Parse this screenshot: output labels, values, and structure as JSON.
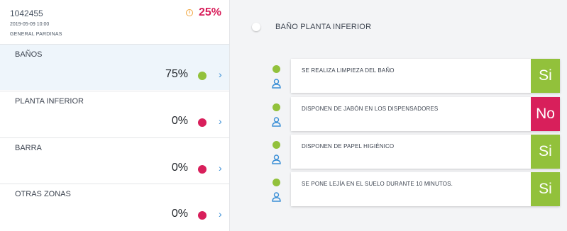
{
  "header": {
    "id": "1042455",
    "date": "2019-05-09 10:00",
    "place": "GENERAL PARDINAS",
    "score": "25%"
  },
  "colors": {
    "green": "#92c13b",
    "pink": "#d81f5b",
    "blue": "#3b8fd6",
    "orange": "#f0a43a"
  },
  "zones": [
    {
      "name": "BAÑOS",
      "percent": "75%",
      "status": "green",
      "active": true
    },
    {
      "name": "PLANTA INFERIOR",
      "percent": "0%",
      "status": "pink",
      "active": false
    },
    {
      "name": "BARRA",
      "percent": "0%",
      "status": "pink",
      "active": false
    },
    {
      "name": "OTRAS ZONAS",
      "percent": "0%",
      "status": "pink",
      "active": false
    }
  ],
  "detail": {
    "title": "BAÑO PLANTA INFERIOR",
    "questions": [
      {
        "text": "SE REALIZA LIMPIEZA DEL BAÑO",
        "answer": "Si",
        "answer_color": "#92c13b"
      },
      {
        "text": "DISPONEN DE JABÓN EN LOS DISPENSADORES",
        "answer": "No",
        "answer_color": "#d81f5b"
      },
      {
        "text": "DISPONEN DE PAPEL HIGIÉNICO",
        "answer": "Si",
        "answer_color": "#92c13b"
      },
      {
        "text": "SE PONE LEJÍA EN EL SUELO DURANTE 10 MINUTOS.",
        "answer": "Si",
        "answer_color": "#92c13b"
      }
    ]
  }
}
